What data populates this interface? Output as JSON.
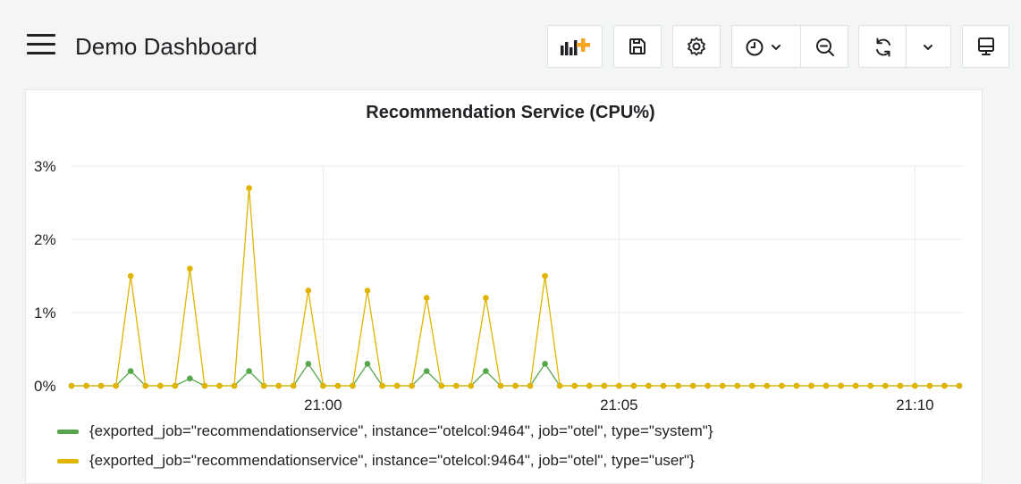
{
  "dashboard": {
    "title": "Demo Dashboard"
  },
  "toolbar": {
    "buttons": [
      "add-panel",
      "save",
      "settings",
      "time-picker",
      "zoom-out",
      "refresh",
      "refresh-interval",
      "view-mode"
    ],
    "accent_color": "#f5a623"
  },
  "panel": {
    "title": "Recommendation Service (CPU%)"
  },
  "chart_data": {
    "type": "line",
    "title": "Recommendation Service (CPU%)",
    "ylabel": "",
    "xlabel": "",
    "ylim": [
      0,
      3
    ],
    "yticks": [
      "0%",
      "1%",
      "2%",
      "3%"
    ],
    "xticks": [
      "21:00",
      "21:05",
      "21:10"
    ],
    "grid": true,
    "legend_position": "bottom-left",
    "series": [
      {
        "name": "{exported_job=\"recommendationservice\", instance=\"otelcol:9464\", job=\"otel\", type=\"system\"}",
        "color": "#56a64b",
        "values": [
          0,
          0,
          0,
          0,
          0.2,
          0,
          0,
          0,
          0.1,
          0,
          0,
          0,
          0.2,
          0,
          0,
          0,
          0.3,
          0,
          0,
          0,
          0.3,
          0,
          0,
          0,
          0.2,
          0,
          0,
          0,
          0.2,
          0,
          0,
          0,
          0.3,
          0,
          0,
          0,
          0,
          0,
          0,
          0,
          0,
          0,
          0,
          0,
          0,
          0,
          0,
          0,
          0,
          0,
          0,
          0,
          0,
          0,
          0,
          0,
          0,
          0,
          0,
          0,
          0
        ]
      },
      {
        "name": "{exported_job=\"recommendationservice\", instance=\"otelcol:9464\", job=\"otel\", type=\"user\"}",
        "color": "#e0b400",
        "values": [
          0,
          0,
          0,
          0,
          1.5,
          0,
          0,
          0,
          1.6,
          0,
          0,
          0,
          2.7,
          0,
          0,
          0,
          1.3,
          0,
          0,
          0,
          1.3,
          0,
          0,
          0,
          1.2,
          0,
          0,
          0,
          1.2,
          0,
          0,
          0,
          1.5,
          0,
          0,
          0,
          0,
          0,
          0,
          0,
          0,
          0,
          0,
          0,
          0,
          0,
          0,
          0,
          0,
          0,
          0,
          0,
          0,
          0,
          0,
          0,
          0,
          0,
          0,
          0,
          0
        ]
      }
    ]
  }
}
